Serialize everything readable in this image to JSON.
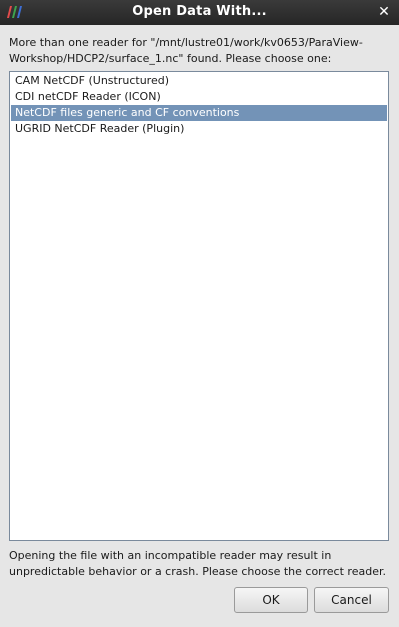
{
  "window": {
    "title": "Open Data With...",
    "close_label": "✕"
  },
  "dialog": {
    "message": "More than one reader for \"/mnt/lustre01/work/kv0653/ParaView-\nWorkshop/HDCP2/surface_1.nc\" found.  Please choose one:",
    "readers": [
      {
        "label": "CAM NetCDF (Unstructured)",
        "selected": false
      },
      {
        "label": "CDI netCDF Reader (ICON)",
        "selected": false
      },
      {
        "label": "NetCDF files generic and CF conventions",
        "selected": true
      },
      {
        "label": "UGRID NetCDF Reader (Plugin)",
        "selected": false
      }
    ],
    "warning": "Opening the file with an incompatible reader may result in unpredictable behavior or a crash.  Please choose the correct reader.",
    "ok_label": "OK",
    "cancel_label": "Cancel"
  },
  "colors": {
    "titlebar": "#2e2e2e",
    "selection": "#7393b7",
    "logo": [
      "#e34b4b",
      "#3fa34d",
      "#3d6fd6"
    ]
  },
  "icons": {
    "app": "paraview-logo-icon",
    "close": "close-icon"
  }
}
